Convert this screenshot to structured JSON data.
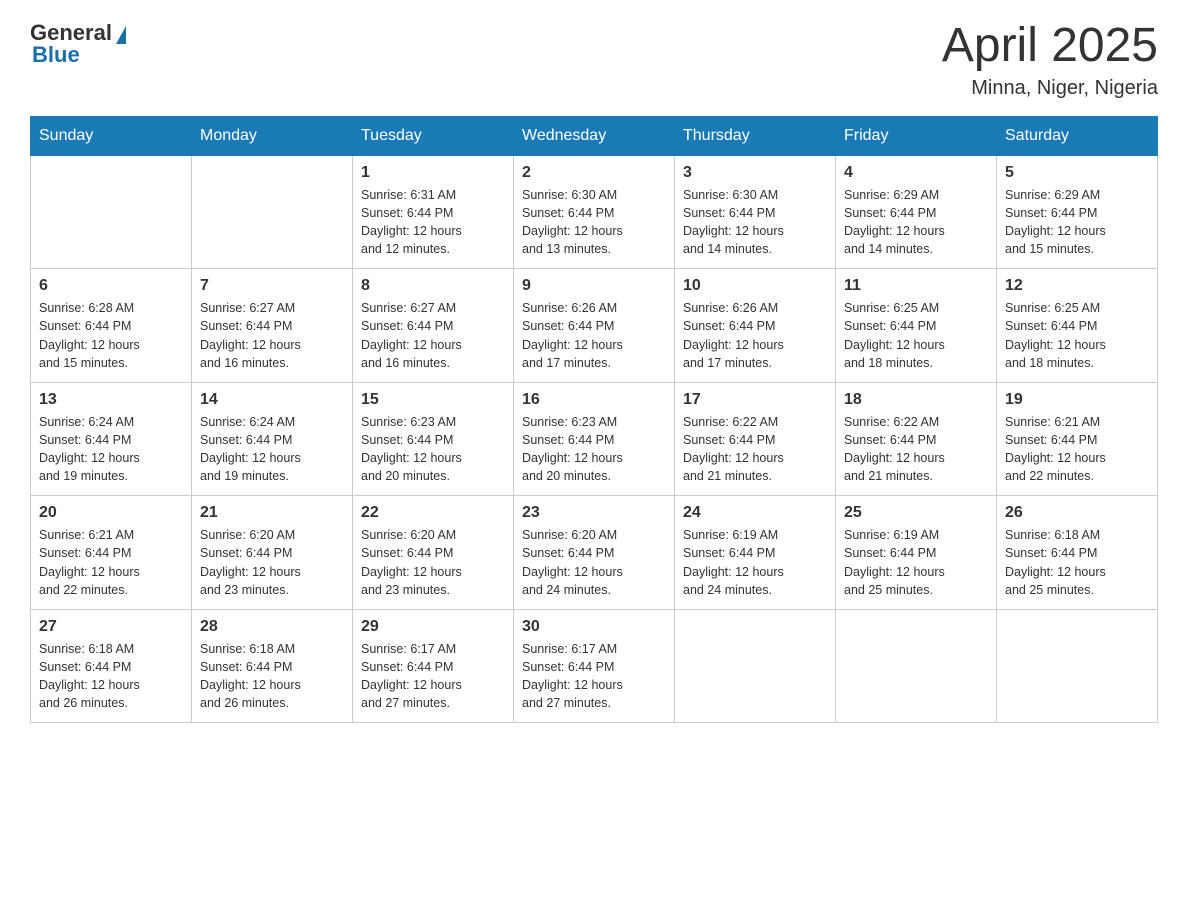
{
  "header": {
    "logo_general": "General",
    "logo_blue": "Blue",
    "month": "April 2025",
    "location": "Minna, Niger, Nigeria"
  },
  "days_of_week": [
    "Sunday",
    "Monday",
    "Tuesday",
    "Wednesday",
    "Thursday",
    "Friday",
    "Saturday"
  ],
  "weeks": [
    [
      {
        "day": "",
        "info": ""
      },
      {
        "day": "",
        "info": ""
      },
      {
        "day": "1",
        "info": "Sunrise: 6:31 AM\nSunset: 6:44 PM\nDaylight: 12 hours\nand 12 minutes."
      },
      {
        "day": "2",
        "info": "Sunrise: 6:30 AM\nSunset: 6:44 PM\nDaylight: 12 hours\nand 13 minutes."
      },
      {
        "day": "3",
        "info": "Sunrise: 6:30 AM\nSunset: 6:44 PM\nDaylight: 12 hours\nand 14 minutes."
      },
      {
        "day": "4",
        "info": "Sunrise: 6:29 AM\nSunset: 6:44 PM\nDaylight: 12 hours\nand 14 minutes."
      },
      {
        "day": "5",
        "info": "Sunrise: 6:29 AM\nSunset: 6:44 PM\nDaylight: 12 hours\nand 15 minutes."
      }
    ],
    [
      {
        "day": "6",
        "info": "Sunrise: 6:28 AM\nSunset: 6:44 PM\nDaylight: 12 hours\nand 15 minutes."
      },
      {
        "day": "7",
        "info": "Sunrise: 6:27 AM\nSunset: 6:44 PM\nDaylight: 12 hours\nand 16 minutes."
      },
      {
        "day": "8",
        "info": "Sunrise: 6:27 AM\nSunset: 6:44 PM\nDaylight: 12 hours\nand 16 minutes."
      },
      {
        "day": "9",
        "info": "Sunrise: 6:26 AM\nSunset: 6:44 PM\nDaylight: 12 hours\nand 17 minutes."
      },
      {
        "day": "10",
        "info": "Sunrise: 6:26 AM\nSunset: 6:44 PM\nDaylight: 12 hours\nand 17 minutes."
      },
      {
        "day": "11",
        "info": "Sunrise: 6:25 AM\nSunset: 6:44 PM\nDaylight: 12 hours\nand 18 minutes."
      },
      {
        "day": "12",
        "info": "Sunrise: 6:25 AM\nSunset: 6:44 PM\nDaylight: 12 hours\nand 18 minutes."
      }
    ],
    [
      {
        "day": "13",
        "info": "Sunrise: 6:24 AM\nSunset: 6:44 PM\nDaylight: 12 hours\nand 19 minutes."
      },
      {
        "day": "14",
        "info": "Sunrise: 6:24 AM\nSunset: 6:44 PM\nDaylight: 12 hours\nand 19 minutes."
      },
      {
        "day": "15",
        "info": "Sunrise: 6:23 AM\nSunset: 6:44 PM\nDaylight: 12 hours\nand 20 minutes."
      },
      {
        "day": "16",
        "info": "Sunrise: 6:23 AM\nSunset: 6:44 PM\nDaylight: 12 hours\nand 20 minutes."
      },
      {
        "day": "17",
        "info": "Sunrise: 6:22 AM\nSunset: 6:44 PM\nDaylight: 12 hours\nand 21 minutes."
      },
      {
        "day": "18",
        "info": "Sunrise: 6:22 AM\nSunset: 6:44 PM\nDaylight: 12 hours\nand 21 minutes."
      },
      {
        "day": "19",
        "info": "Sunrise: 6:21 AM\nSunset: 6:44 PM\nDaylight: 12 hours\nand 22 minutes."
      }
    ],
    [
      {
        "day": "20",
        "info": "Sunrise: 6:21 AM\nSunset: 6:44 PM\nDaylight: 12 hours\nand 22 minutes."
      },
      {
        "day": "21",
        "info": "Sunrise: 6:20 AM\nSunset: 6:44 PM\nDaylight: 12 hours\nand 23 minutes."
      },
      {
        "day": "22",
        "info": "Sunrise: 6:20 AM\nSunset: 6:44 PM\nDaylight: 12 hours\nand 23 minutes."
      },
      {
        "day": "23",
        "info": "Sunrise: 6:20 AM\nSunset: 6:44 PM\nDaylight: 12 hours\nand 24 minutes."
      },
      {
        "day": "24",
        "info": "Sunrise: 6:19 AM\nSunset: 6:44 PM\nDaylight: 12 hours\nand 24 minutes."
      },
      {
        "day": "25",
        "info": "Sunrise: 6:19 AM\nSunset: 6:44 PM\nDaylight: 12 hours\nand 25 minutes."
      },
      {
        "day": "26",
        "info": "Sunrise: 6:18 AM\nSunset: 6:44 PM\nDaylight: 12 hours\nand 25 minutes."
      }
    ],
    [
      {
        "day": "27",
        "info": "Sunrise: 6:18 AM\nSunset: 6:44 PM\nDaylight: 12 hours\nand 26 minutes."
      },
      {
        "day": "28",
        "info": "Sunrise: 6:18 AM\nSunset: 6:44 PM\nDaylight: 12 hours\nand 26 minutes."
      },
      {
        "day": "29",
        "info": "Sunrise: 6:17 AM\nSunset: 6:44 PM\nDaylight: 12 hours\nand 27 minutes."
      },
      {
        "day": "30",
        "info": "Sunrise: 6:17 AM\nSunset: 6:44 PM\nDaylight: 12 hours\nand 27 minutes."
      },
      {
        "day": "",
        "info": ""
      },
      {
        "day": "",
        "info": ""
      },
      {
        "day": "",
        "info": ""
      }
    ]
  ]
}
